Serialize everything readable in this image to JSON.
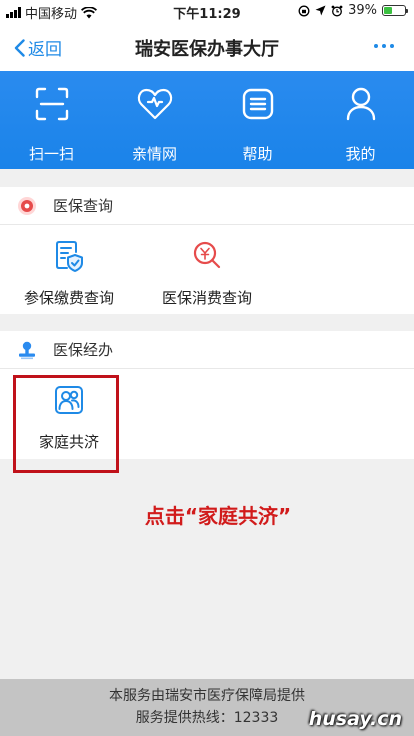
{
  "status_bar": {
    "carrier": "中国移动",
    "time": "下午11:29",
    "battery": "39%",
    "battery_level": 0.39
  },
  "nav": {
    "back_label": "返回",
    "title": "瑞安医保办事大厅"
  },
  "banner": {
    "items": [
      {
        "label": "扫一扫",
        "icon": "scan-icon"
      },
      {
        "label": "亲情网",
        "icon": "heart-icon"
      },
      {
        "label": "帮助",
        "icon": "help-list-icon"
      },
      {
        "label": "我的",
        "icon": "user-icon"
      }
    ]
  },
  "sections": [
    {
      "title": "医保查询",
      "icon": "query-icon",
      "tiles": [
        {
          "label": "参保缴费查询",
          "icon": "insurance-payment-icon"
        },
        {
          "label": "医保消费查询",
          "icon": "consumption-search-icon"
        }
      ]
    },
    {
      "title": "医保经办",
      "icon": "stamp-icon",
      "tiles": [
        {
          "label": "家庭共济",
          "icon": "family-icon"
        }
      ]
    }
  ],
  "annotation": "点击“家庭共济”",
  "footer": {
    "line1": "本服务由瑞安市医疗保障局提供",
    "line2": "服务提供热线：12333"
  },
  "watermark": "husay.cn",
  "colors": {
    "accent": "#1f8ae6",
    "highlight": "#c0111a",
    "annotation": "#d11b1b"
  }
}
